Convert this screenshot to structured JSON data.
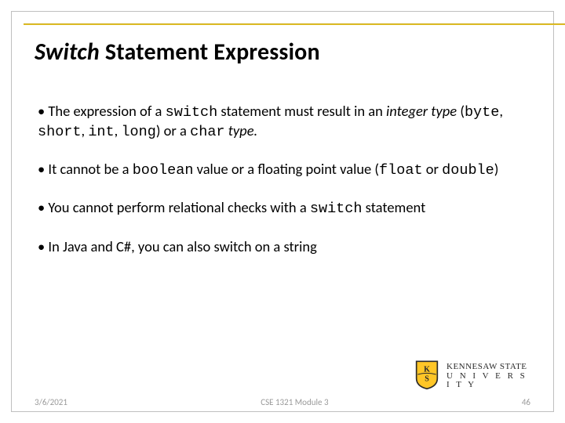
{
  "title": {
    "word1_italic": "Switch",
    "rest": " Statement Expression"
  },
  "bullets": {
    "b1": {
      "pre": "The expression of a ",
      "code1": "switch",
      "mid1": " statement must result in an ",
      "ital1": "integer type",
      "mid2": " (",
      "code2": "byte",
      "c": ", ",
      "code3": "short",
      "c2": ", ",
      "code4": "int",
      "c3": ", ",
      "code5": "long",
      "mid3": ") or a ",
      "code6": "char",
      "post": " type."
    },
    "b2": {
      "pre": "It cannot be a ",
      "code1": "boolean",
      "mid1": " value or a floating point value (",
      "code2": "float",
      "mid2": " or ",
      "code3": "double",
      "post": ")"
    },
    "b3": {
      "pre": "You cannot perform relational checks with a ",
      "code1": "switch",
      "post": " statement"
    },
    "b4": {
      "text": "In Java and C#, you can also switch on a string"
    }
  },
  "footer": {
    "date": "3/6/2021",
    "center": "CSE 1321 Module 3",
    "page": "46"
  },
  "logo": {
    "line1": "KENNESAW STATE",
    "line2": "U N I V E R S I T Y"
  }
}
